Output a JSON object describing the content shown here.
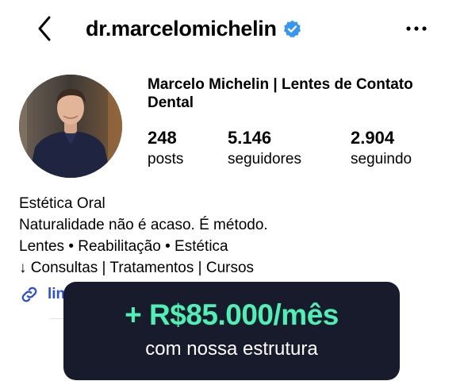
{
  "header": {
    "username": "dr.marcelomichelin",
    "verified": true,
    "accent": "#3897f0"
  },
  "profile": {
    "name": "Marcelo Michelin | Lentes de Contato Dental",
    "stats": [
      {
        "value": "248",
        "label": "posts"
      },
      {
        "value": "5.146",
        "label": "seguidores"
      },
      {
        "value": "2.904",
        "label": "seguindo"
      }
    ],
    "bio": [
      "Estética Oral",
      "Naturalidade não é acaso. É método.",
      "Lentes • Reabilitação • Estética",
      "↓ Consultas | Tratamentos | Cursos"
    ],
    "link_text": "lin",
    "link_color": "#2f4fd8"
  },
  "promo": {
    "headline": "+ R$85.000/mês",
    "subline": "com nossa estrutura",
    "background": "#181b2c",
    "accent": "#4ef0b3"
  },
  "icons": {
    "back": "chevron-left-icon",
    "verified": "verified-badge-icon",
    "more": "more-horizontal-icon",
    "link": "link-icon"
  }
}
